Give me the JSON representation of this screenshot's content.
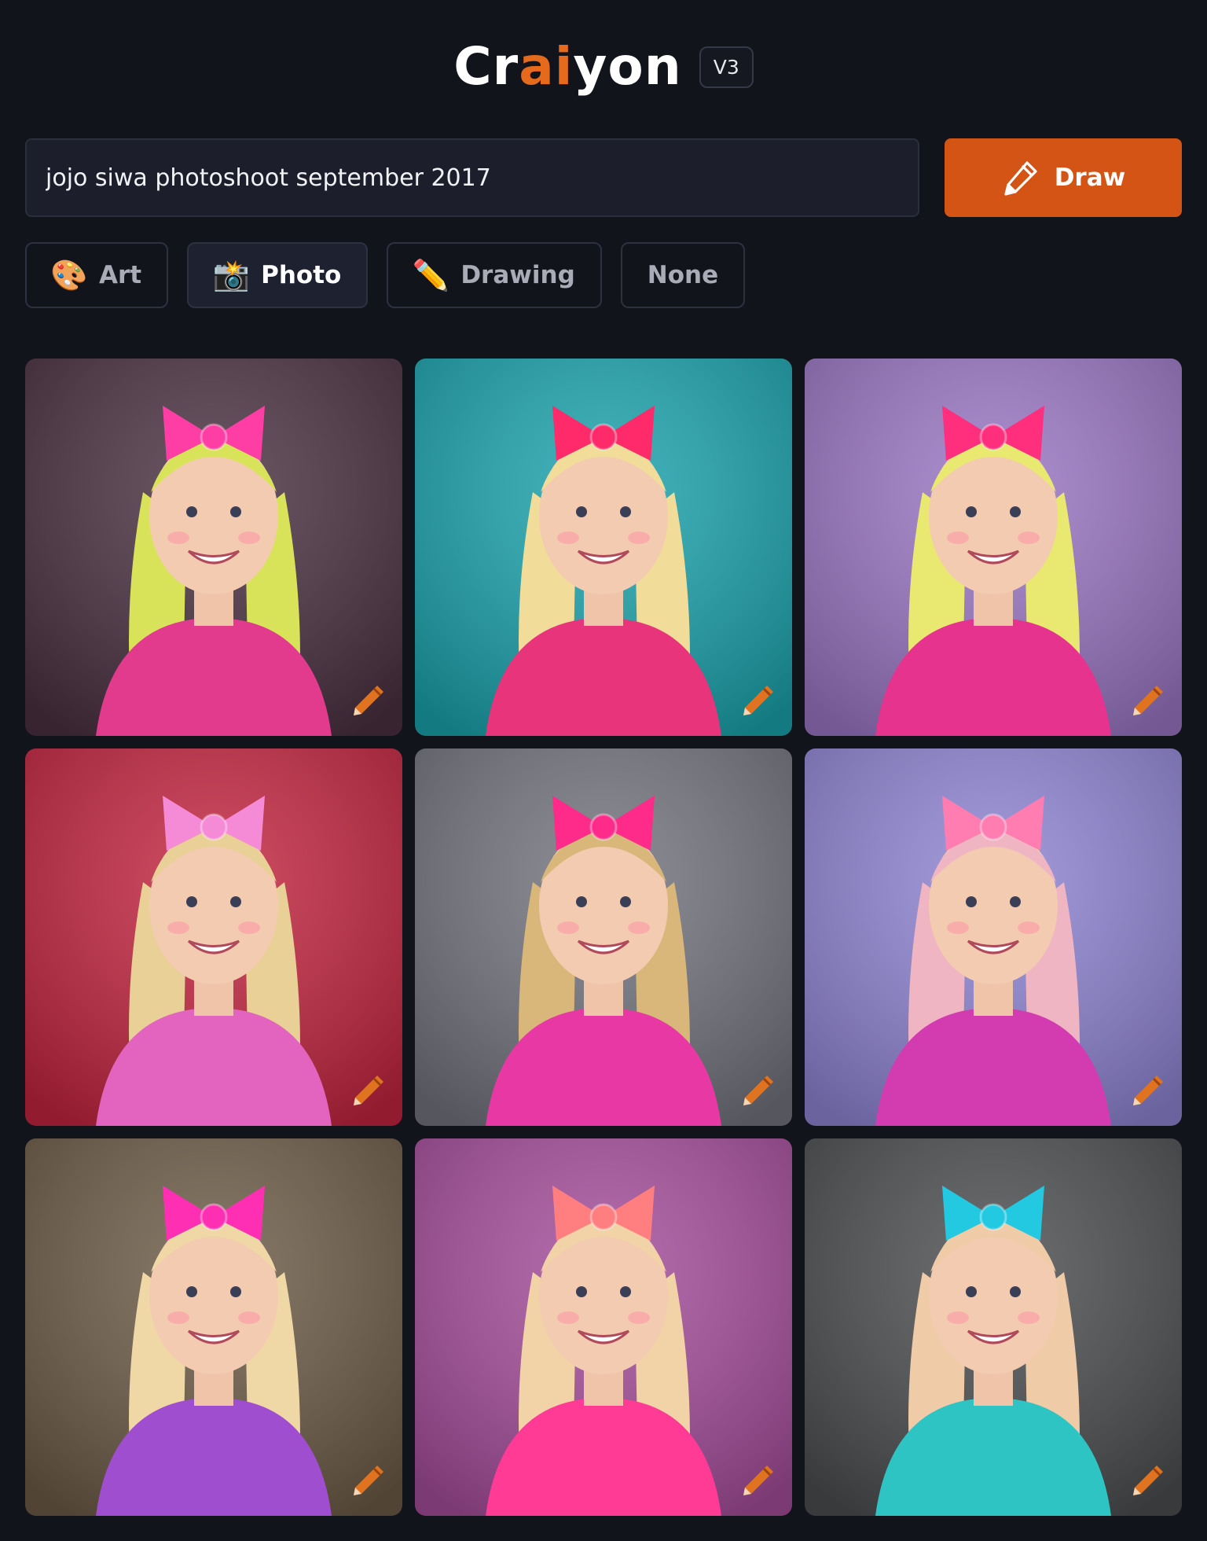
{
  "header": {
    "logo_part1": "Cr",
    "logo_accent": "ai",
    "logo_part2": "yon",
    "version": "V3"
  },
  "prompt": {
    "value": "jojo siwa photoshoot september 2017",
    "placeholder": "jojo siwa photoshoot september 2017"
  },
  "draw_button": {
    "label": "Draw",
    "icon": "pencil-icon"
  },
  "styles": [
    {
      "label": "Art",
      "icon": "palette-icon",
      "emoji": "🎨",
      "active": false
    },
    {
      "label": "Photo",
      "icon": "camera-flash-icon",
      "emoji": "📸",
      "active": true
    },
    {
      "label": "Drawing",
      "icon": "pencil-icon",
      "emoji": "✏️",
      "active": false
    },
    {
      "label": "None",
      "icon": "",
      "emoji": "",
      "active": false
    }
  ],
  "results": [
    {
      "bg": "#4a3040",
      "bow": "#ff3ea5",
      "hair": "#d9e35a",
      "outfit": "#e23b8e",
      "icon": "edit-pencil-icon"
    },
    {
      "bg": "#1ba3ad",
      "bow": "#ff2a6a",
      "hair": "#f1dc9a",
      "outfit": "#e8347a",
      "icon": "edit-pencil-icon"
    },
    {
      "bg": "#9a76c4",
      "bow": "#ff2f7d",
      "hair": "#e9e870",
      "outfit": "#e6338d",
      "icon": "edit-pencil-icon"
    },
    {
      "bg": "#c3243f",
      "bow": "#f58ad6",
      "hair": "#e8d096",
      "outfit": "#e364bf",
      "icon": "edit-pencil-icon"
    },
    {
      "bg": "#72737d",
      "bow": "#ff2b8a",
      "hair": "#d9b77a",
      "outfit": "#e838a4",
      "icon": "edit-pencil-icon"
    },
    {
      "bg": "#8f84d3",
      "bow": "#ff7db0",
      "hair": "#f0b5c2",
      "outfit": "#d33bb0",
      "icon": "edit-pencil-icon"
    },
    {
      "bg": "#6c5b46",
      "bow": "#ff2fb3",
      "hair": "#efd8a6",
      "outfit": "#a04ed0",
      "icon": "edit-pencil-icon"
    },
    {
      "bg": "#a54d9b",
      "bow": "#ff7f80",
      "hair": "#f1d3a7",
      "outfit": "#ff3b95",
      "icon": "edit-pencil-icon"
    },
    {
      "bg": "#4b4d4f",
      "bow": "#22c9e0",
      "hair": "#f0cba7",
      "outfit": "#2fc4c4",
      "icon": "edit-pencil-icon"
    }
  ]
}
